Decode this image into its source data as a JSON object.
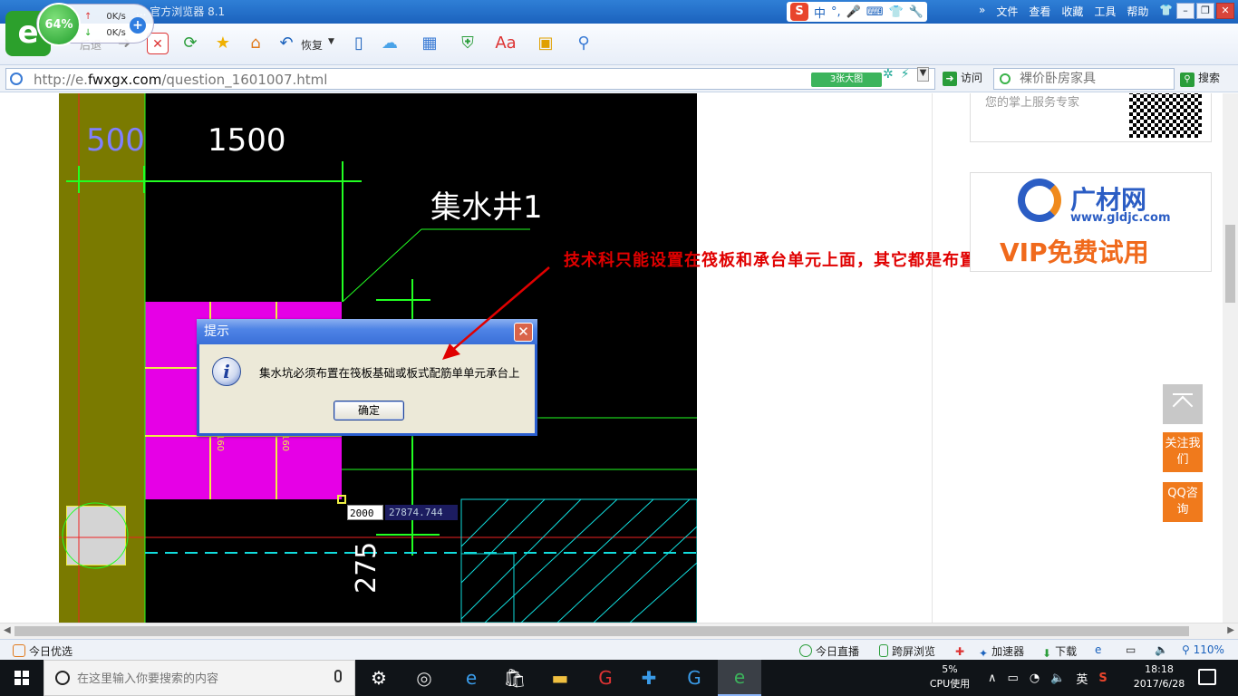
{
  "window": {
    "title": "... 官方浏览器 8.1",
    "menu": [
      "文件",
      "查看",
      "收藏",
      "工具",
      "帮助"
    ],
    "controls": [
      "–",
      "❐",
      "✕"
    ]
  },
  "speed_widget": {
    "percent": "64%",
    "up": "0K/s",
    "down": "0K/s"
  },
  "ime": {
    "mode": "中",
    "punct": "°,"
  },
  "toolbar": {
    "back_label": "后退",
    "restore_label": "恢复"
  },
  "address": {
    "url_prefix": "http://e.",
    "url_domain": "fwxgx.com",
    "url_path": "/question_1601007.html",
    "bigpic_label": "3张大图",
    "visit_label": "访问",
    "search_placeholder": "裸价卧房家具",
    "search_label": "搜索"
  },
  "cad": {
    "dim_500": "500",
    "dim_1500": "1500",
    "sump_label": "集水井1",
    "dim_275": "275",
    "dim_input": "2000",
    "coord": "27874.744",
    "label_160_a": "160",
    "label_160_b": "160"
  },
  "dialog": {
    "title": "提示",
    "message": "集水坑必须布置在筏板基础或板式配筋单单元承台上",
    "ok_label": "确定"
  },
  "annotation": "技术科只能设置在筏板和承台单元上面，其它都是布置不了的",
  "sidebar": {
    "card1_text": "您的掌上服务专家",
    "ad_brand": "广材网",
    "ad_url": "www.gldjc.com",
    "ad_slogan": "VIP免费试用",
    "follow_label": "关注我们",
    "qq_label": "QQ咨询"
  },
  "statusbar": {
    "left": "今日优选",
    "live": "今日直播",
    "cross_screen": "跨屏浏览",
    "accelerator": "加速器",
    "download": "下载",
    "zoom": "110%"
  },
  "taskbar": {
    "search_placeholder": "在这里输入你要搜索的内容",
    "cpu_percent": "5%",
    "cpu_label": "CPU使用",
    "ime_lang": "英",
    "time": "18:18",
    "date": "2017/6/28"
  },
  "colors": {
    "annotation_red": "#e00000",
    "cad_green": "#22ff22",
    "cad_magenta": "#e600e6",
    "dialog_blue": "#2b5fd0",
    "accent_orange": "#f07a1c"
  }
}
